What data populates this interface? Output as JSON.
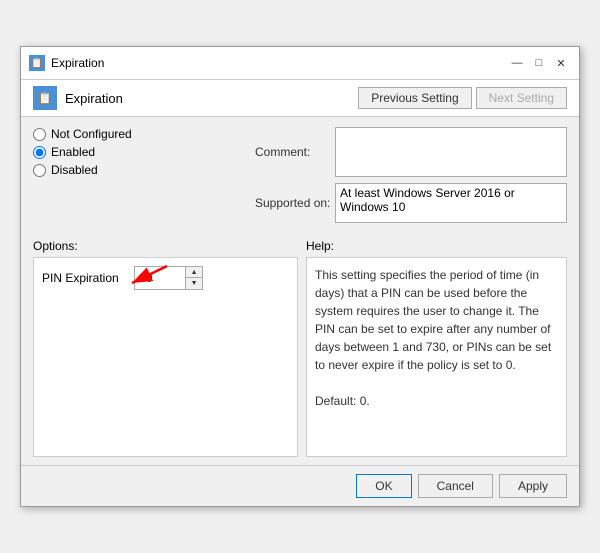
{
  "window": {
    "title": "Expiration",
    "icon": "📋"
  },
  "header": {
    "title": "Expiration",
    "prev_btn": "Previous Setting",
    "next_btn": "Next Setting"
  },
  "radio": {
    "not_configured": "Not Configured",
    "enabled": "Enabled",
    "disabled": "Disabled",
    "selected": "enabled"
  },
  "comment": {
    "label": "Comment:",
    "value": ""
  },
  "supported": {
    "label": "Supported on:",
    "value": "At least Windows Server 2016 or Windows 10"
  },
  "options": {
    "label": "Options:",
    "pin_label": "PIN Expiration",
    "pin_value": "30"
  },
  "help": {
    "label": "Help:",
    "text": "This setting specifies the period of time (in days) that a PIN can be used before the system requires the user to change it. The PIN can be set to expire after any number of days between 1 and 730, or PINs can be set to never expire if the policy is set to 0.\n\nDefault: 0."
  },
  "footer": {
    "ok": "OK",
    "cancel": "Cancel",
    "apply": "Apply"
  },
  "title_controls": {
    "minimize": "—",
    "maximize": "□",
    "close": "✕"
  }
}
